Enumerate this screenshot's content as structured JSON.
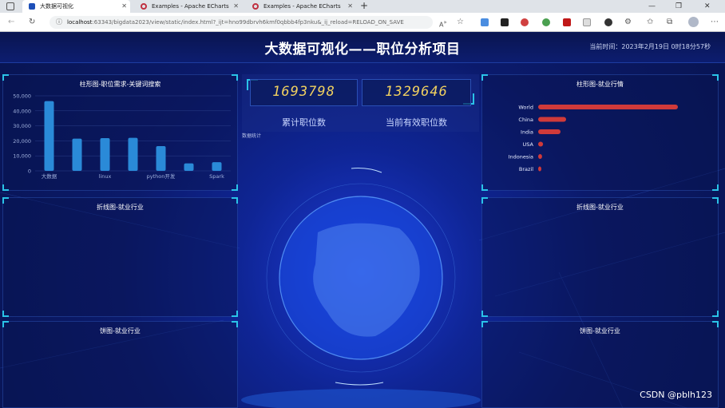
{
  "browser": {
    "tabs": [
      {
        "label": "大数据可视化",
        "active": true
      },
      {
        "label": "Examples - Apache ECharts",
        "active": false
      },
      {
        "label": "Examples - Apache ECharts",
        "active": false
      }
    ],
    "url_host": "localhost",
    "url_rest": ":63343/bigdata2023/view/static/index.html?_ijt=hno99dbrvh6kmf0qbbb4fp3nku&_ij_reload=RELOAD_ON_SAVE"
  },
  "dashboard": {
    "title": "大数据可视化——职位分析项目",
    "time_label": "当前时间：",
    "time_value": "2023年2月19日 0时18分57秒",
    "counters": [
      {
        "value": "1693798",
        "label": "累计职位数"
      },
      {
        "value": "1329646",
        "label": "当前有效职位数"
      }
    ],
    "small_tag": "数据统计",
    "panels": {
      "left1": "柱形图-职位需求-关键词搜索",
      "left2": "折线图-就业行业",
      "left3": "饼图-就业行业",
      "right1": "柱形图-就业行情",
      "right2": "折线图-就业行业",
      "right3": "饼图-就业行业"
    },
    "watermark": "CSDN @pblh123"
  },
  "chart_data": [
    {
      "type": "bar",
      "title": "柱形图-职位需求-关键词搜索",
      "categories": [
        "大数据",
        "",
        "linux",
        "",
        "python开发",
        "",
        "Spark"
      ],
      "values": [
        46500,
        21500,
        21800,
        22000,
        16500,
        5000,
        5800
      ],
      "yticks": [
        "0",
        "10,000",
        "20,000",
        "30,000",
        "40,000",
        "50,000"
      ],
      "ylim": [
        0,
        50000
      ],
      "color": "#2a8ad8"
    },
    {
      "type": "bar",
      "orientation": "horizontal",
      "title": "柱形图-就业行情",
      "categories": [
        "World",
        "China",
        "India",
        "USA",
        "Indonesia",
        "Brazil"
      ],
      "values": [
        100,
        20,
        16,
        3.5,
        2.8,
        2.2
      ],
      "color": "#d03a3a"
    }
  ]
}
